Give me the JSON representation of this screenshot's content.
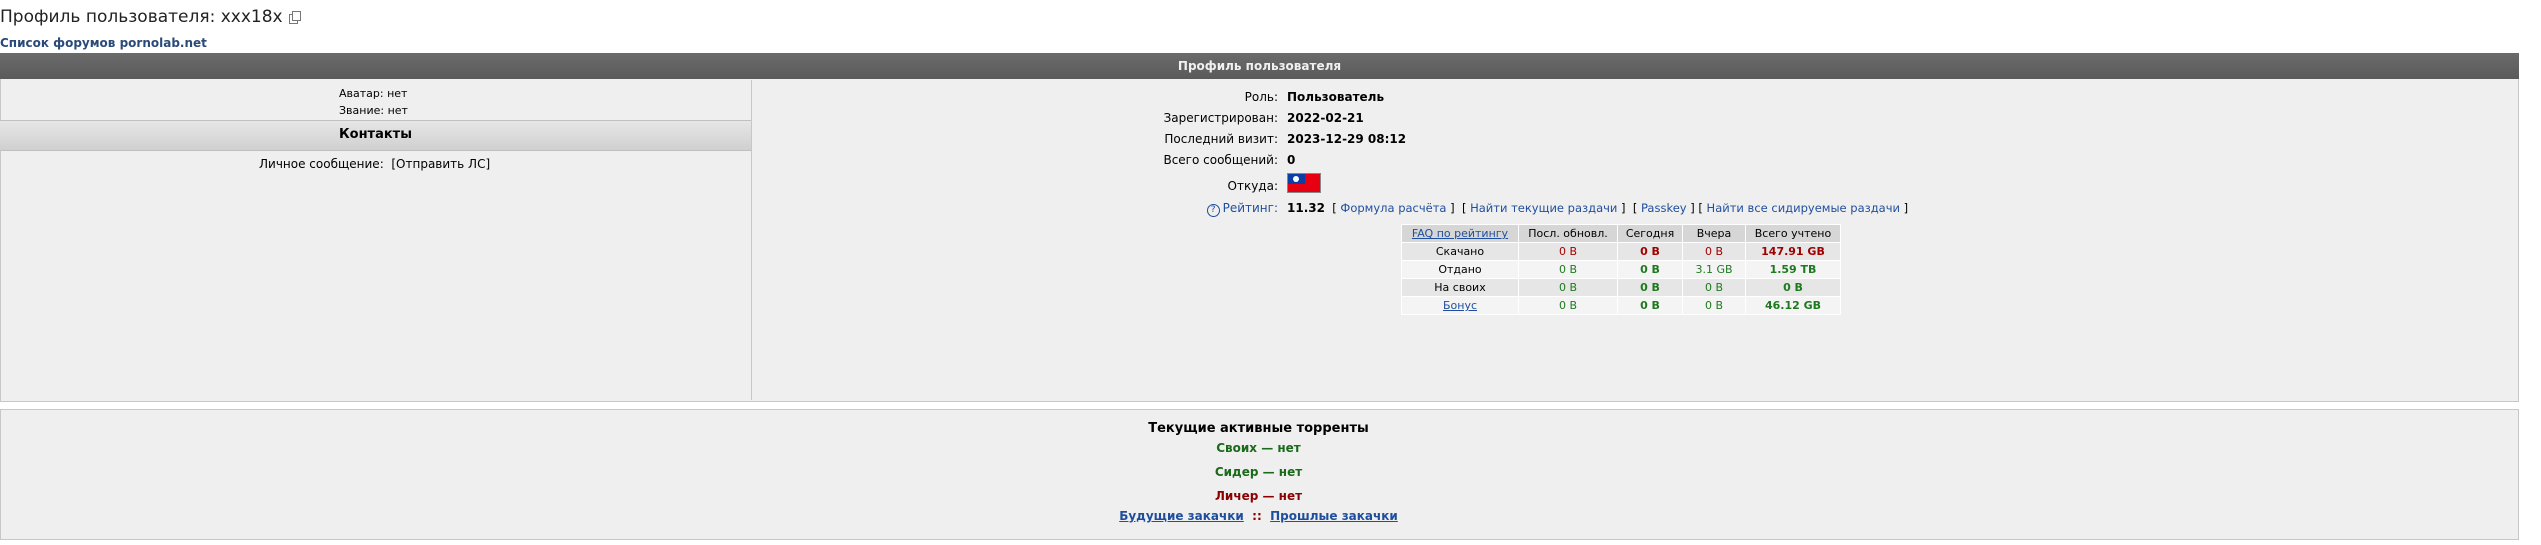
{
  "header": {
    "title": "Профиль пользователя: xxx18x",
    "forum_link": "Список форумов pornolab.net"
  },
  "profile": {
    "section_title": "Профиль пользователя",
    "avatar_label": "Аватар:",
    "avatar_value": "нет",
    "rank_label": "Звание:",
    "rank_value": "нет",
    "contacts_title": "Контакты",
    "pm_label": "Личное сообщение:",
    "pm_button": "[Отправить ЛС]",
    "fields": [
      {
        "label": "Роль:",
        "value": "Пользователь"
      },
      {
        "label": "Зарегистрирован:",
        "value": "2022-02-21"
      },
      {
        "label": "Последний визит:",
        "value": "2023-12-29 08:12"
      },
      {
        "label": "Всего сообщений:",
        "value": "0"
      }
    ],
    "from_label": "Откуда:",
    "flag": {
      "name": "taiwan-flag-icon",
      "colors": [
        "#e60012",
        "#0b3fa6",
        "#ffffff"
      ]
    },
    "rating_label": "Рейтинг:",
    "rating_value": "11.32",
    "rating_links": [
      "Формула расчёта",
      "Найти текущие раздачи",
      "Passkey",
      "Найти все сидируемые раздачи"
    ]
  },
  "stats": {
    "headers": [
      "FAQ по рейтингу",
      "Посл. обновл.",
      "Сегодня",
      "Вчера",
      "Всего учтено"
    ],
    "rows": [
      {
        "label": "Скачано",
        "cells": [
          "0 B",
          "0 B",
          "0 B",
          "147.91 GB"
        ]
      },
      {
        "label": "Отдано",
        "cells": [
          "0 B",
          "0 B",
          "3.1 GB",
          "1.59 TB"
        ]
      },
      {
        "label": "На своих",
        "cells": [
          "0 B",
          "0 B",
          "0 B",
          "0 B"
        ]
      },
      {
        "label": "Бонус",
        "cells": [
          "0 B",
          "0 B",
          "0 B",
          "46.12 GB"
        ]
      }
    ]
  },
  "torrents": {
    "title": "Текущие активные торренты",
    "own": "Своих — нет",
    "seeder": "Сидер — нет",
    "leecher": "Личер — нет",
    "future_link": "Будущие закачки",
    "separator": "::",
    "past_link": "Прошлые закачки"
  }
}
